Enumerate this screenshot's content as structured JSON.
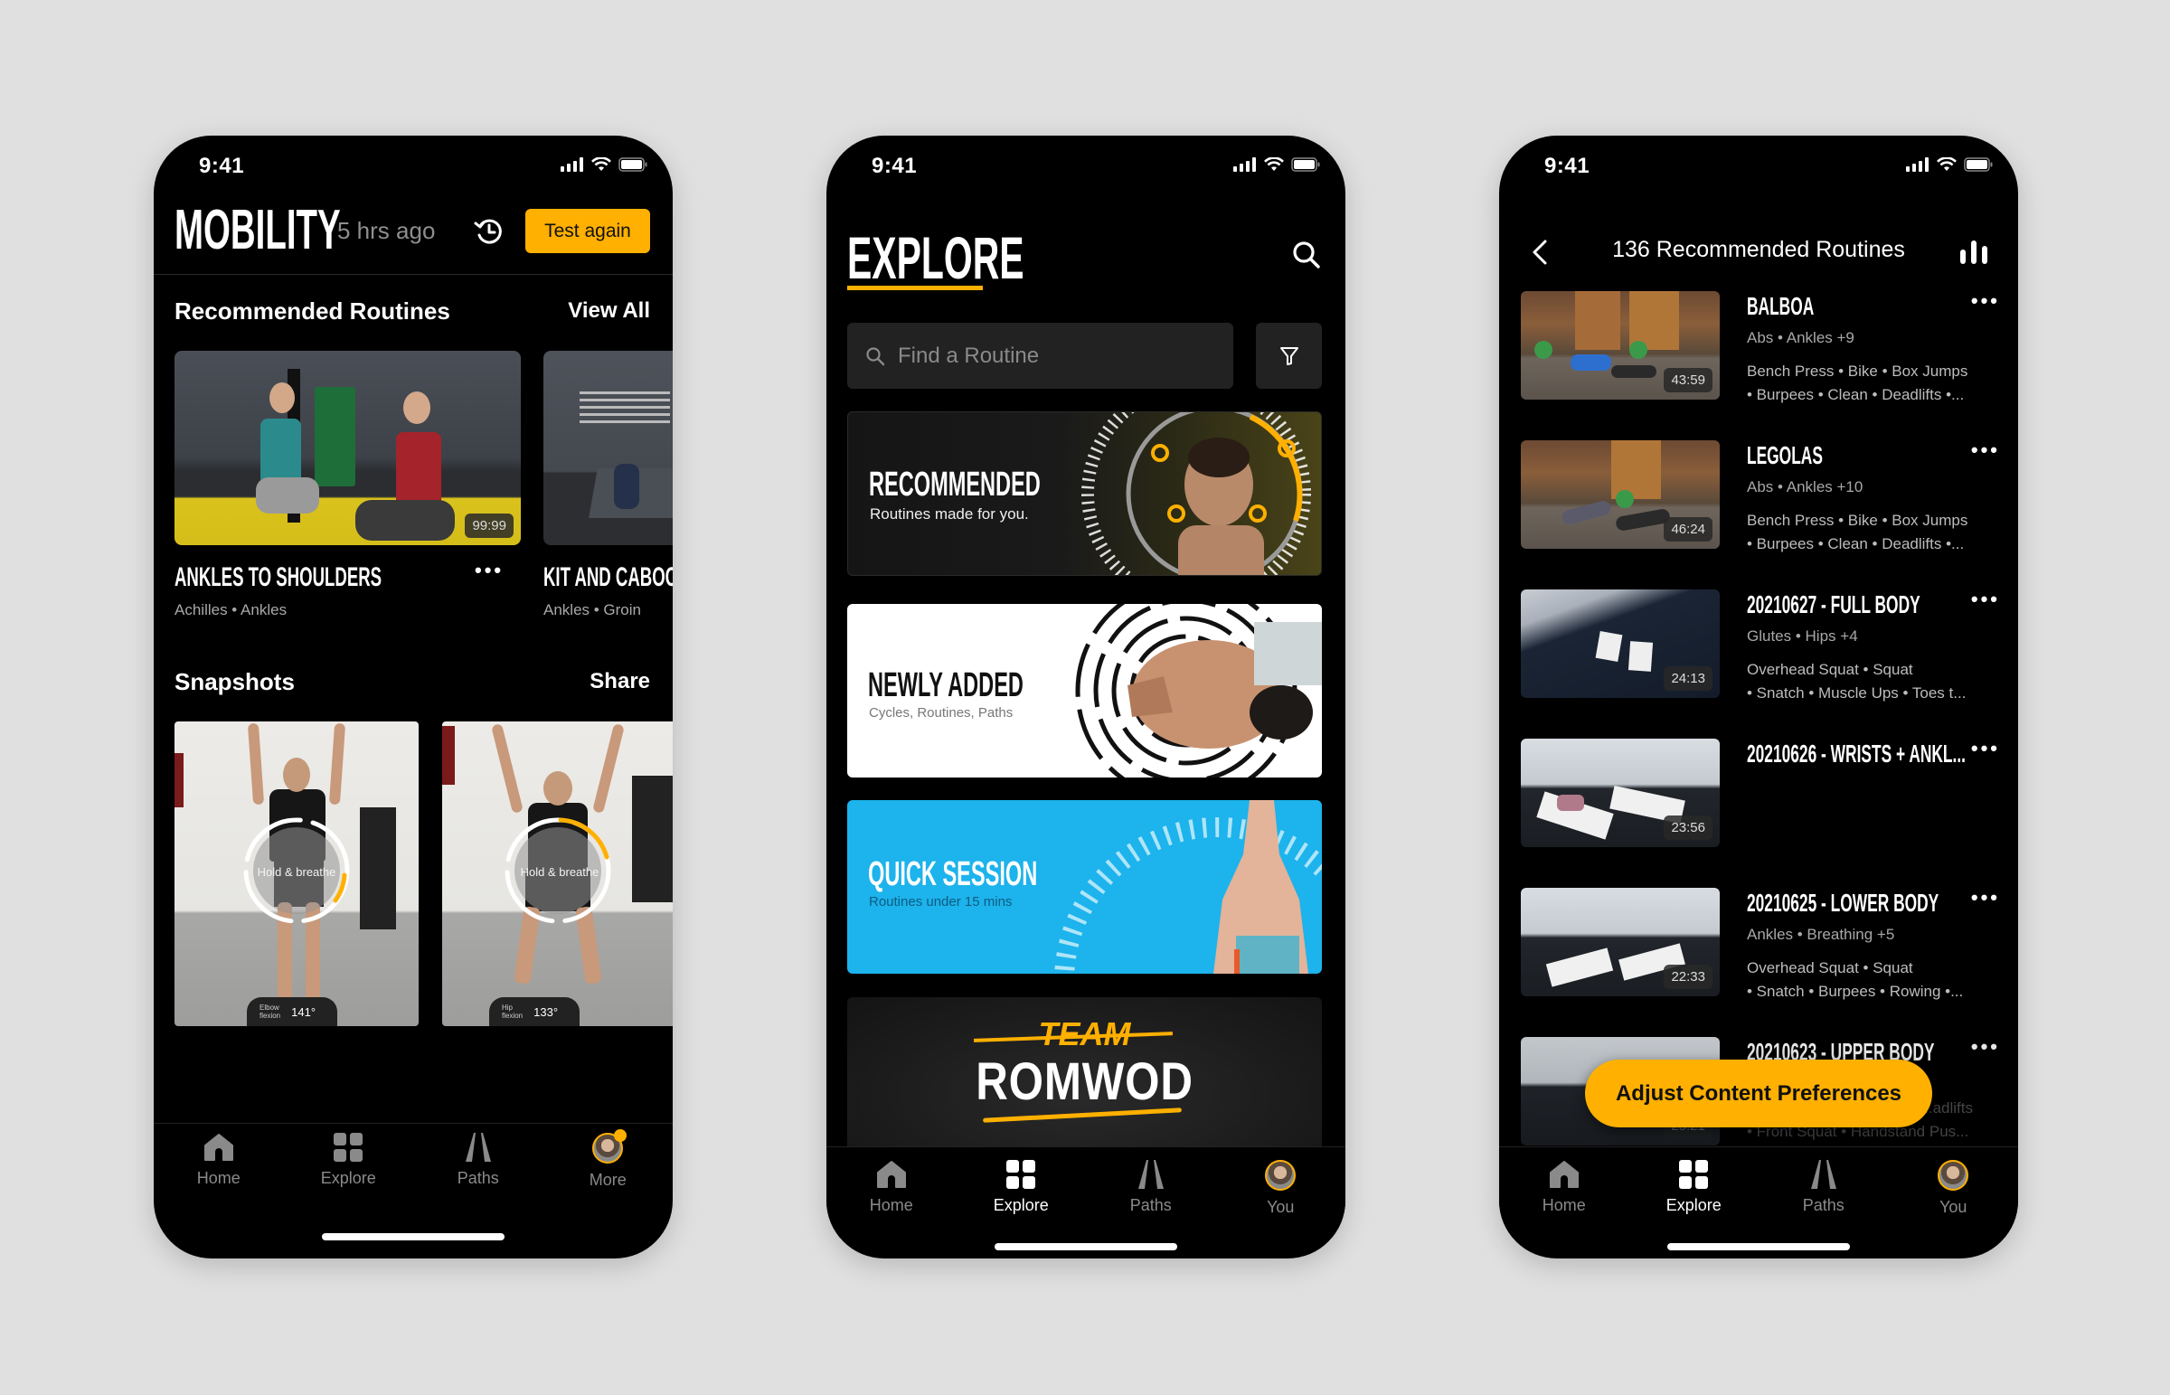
{
  "colors": {
    "accent": "#FFB000",
    "background": "#E0E0E0",
    "phone_bg": "#000000",
    "quick_session_blue": "#1DB3EC"
  },
  "status_bar": {
    "time": "9:41",
    "icons": [
      "signal-icon",
      "wifi-icon",
      "battery-icon"
    ]
  },
  "mobility_screen": {
    "title": "MOBILITY",
    "last_tested": "5 hrs ago",
    "history_icon": "history-icon",
    "test_again_label": "Test again",
    "recommended": {
      "heading": "Recommended Routines",
      "view_all_label": "View All",
      "cards": [
        {
          "title": "ANKLES TO SHOULDERS",
          "tags": "Achilles • Ankles",
          "duration": "99:99"
        },
        {
          "title": "KIT AND CABOODLE",
          "tags": "Ankles • Groin"
        }
      ]
    },
    "snapshots": {
      "heading": "Snapshots",
      "share_label": "Share",
      "items": [
        {
          "overlay_text": "Hold & breathe",
          "metric_label_1": "Elbow",
          "metric_label_2": "flexion",
          "metric_value": "141°"
        },
        {
          "overlay_text": "Hold & breathe",
          "metric_label_1": "Hip",
          "metric_label_2": "flexion",
          "metric_value": "133°"
        }
      ]
    },
    "tabs": [
      {
        "label": "Home",
        "icon": "home-icon",
        "active": false
      },
      {
        "label": "Explore",
        "icon": "grid-icon",
        "active": false
      },
      {
        "label": "Paths",
        "icon": "paths-icon",
        "active": false
      },
      {
        "label": "More",
        "icon": "avatar",
        "active": false,
        "badge": true
      }
    ]
  },
  "explore_screen": {
    "title": "EXPLORE",
    "search_placeholder": "Find a Routine",
    "banners": [
      {
        "title": "RECOMMENDED",
        "subtitle": "Routines made for you."
      },
      {
        "title": "NEWLY ADDED",
        "subtitle": "Cycles, Routines, Paths"
      },
      {
        "title": "QUICK SESSION",
        "subtitle": "Routines under 15 mins"
      },
      {
        "title_small": "TEAM",
        "title": "ROMWOD"
      }
    ],
    "tabs": [
      {
        "label": "Home",
        "icon": "home-icon",
        "active": false
      },
      {
        "label": "Explore",
        "icon": "grid-icon",
        "active": true
      },
      {
        "label": "Paths",
        "icon": "paths-icon",
        "active": false
      },
      {
        "label": "You",
        "icon": "avatar",
        "active": false
      }
    ]
  },
  "routines_screen": {
    "title": "136 Recommended Routines",
    "routines": [
      {
        "title": "BALBOA",
        "tags": "Abs • Ankles +9",
        "exercises_1": "Bench Press • Bike • Box Jumps",
        "exercises_2": "• Burpees • Clean • Deadlifts •...",
        "duration": "43:59"
      },
      {
        "title": "LEGOLAS",
        "tags": "Abs • Ankles +10",
        "exercises_1": "Bench Press • Bike • Box Jumps",
        "exercises_2": "• Burpees • Clean • Deadlifts •...",
        "duration": "46:24"
      },
      {
        "title": "20210627 - FULL BODY",
        "tags": "Glutes • Hips +4",
        "exercises_1": "Overhead Squat • Squat",
        "exercises_2": "• Snatch • Muscle Ups • Toes t...",
        "duration": "24:13"
      },
      {
        "title": "20210626 - WRISTS + ANKL...",
        "tags": "",
        "exercises_1": "",
        "exercises_2": "",
        "duration": "23:56"
      },
      {
        "title": "20210625 - LOWER BODY",
        "tags": "Ankles • Breathing +5",
        "exercises_1": "Overhead Squat • Squat",
        "exercises_2": "• Snatch • Burpees • Rowing •...",
        "duration": "22:33"
      },
      {
        "title": "20210623 - UPPER BODY",
        "tags": "",
        "exercises_1": "...adlifts",
        "exercises_2": "• Front Squat • Handstand Pus...",
        "duration": "25:21"
      }
    ],
    "adjust_label": "Adjust Content Preferences",
    "tabs": [
      {
        "label": "Home",
        "icon": "home-icon",
        "active": false
      },
      {
        "label": "Explore",
        "icon": "grid-icon",
        "active": true
      },
      {
        "label": "Paths",
        "icon": "paths-icon",
        "active": false
      },
      {
        "label": "You",
        "icon": "avatar",
        "active": false
      }
    ]
  }
}
